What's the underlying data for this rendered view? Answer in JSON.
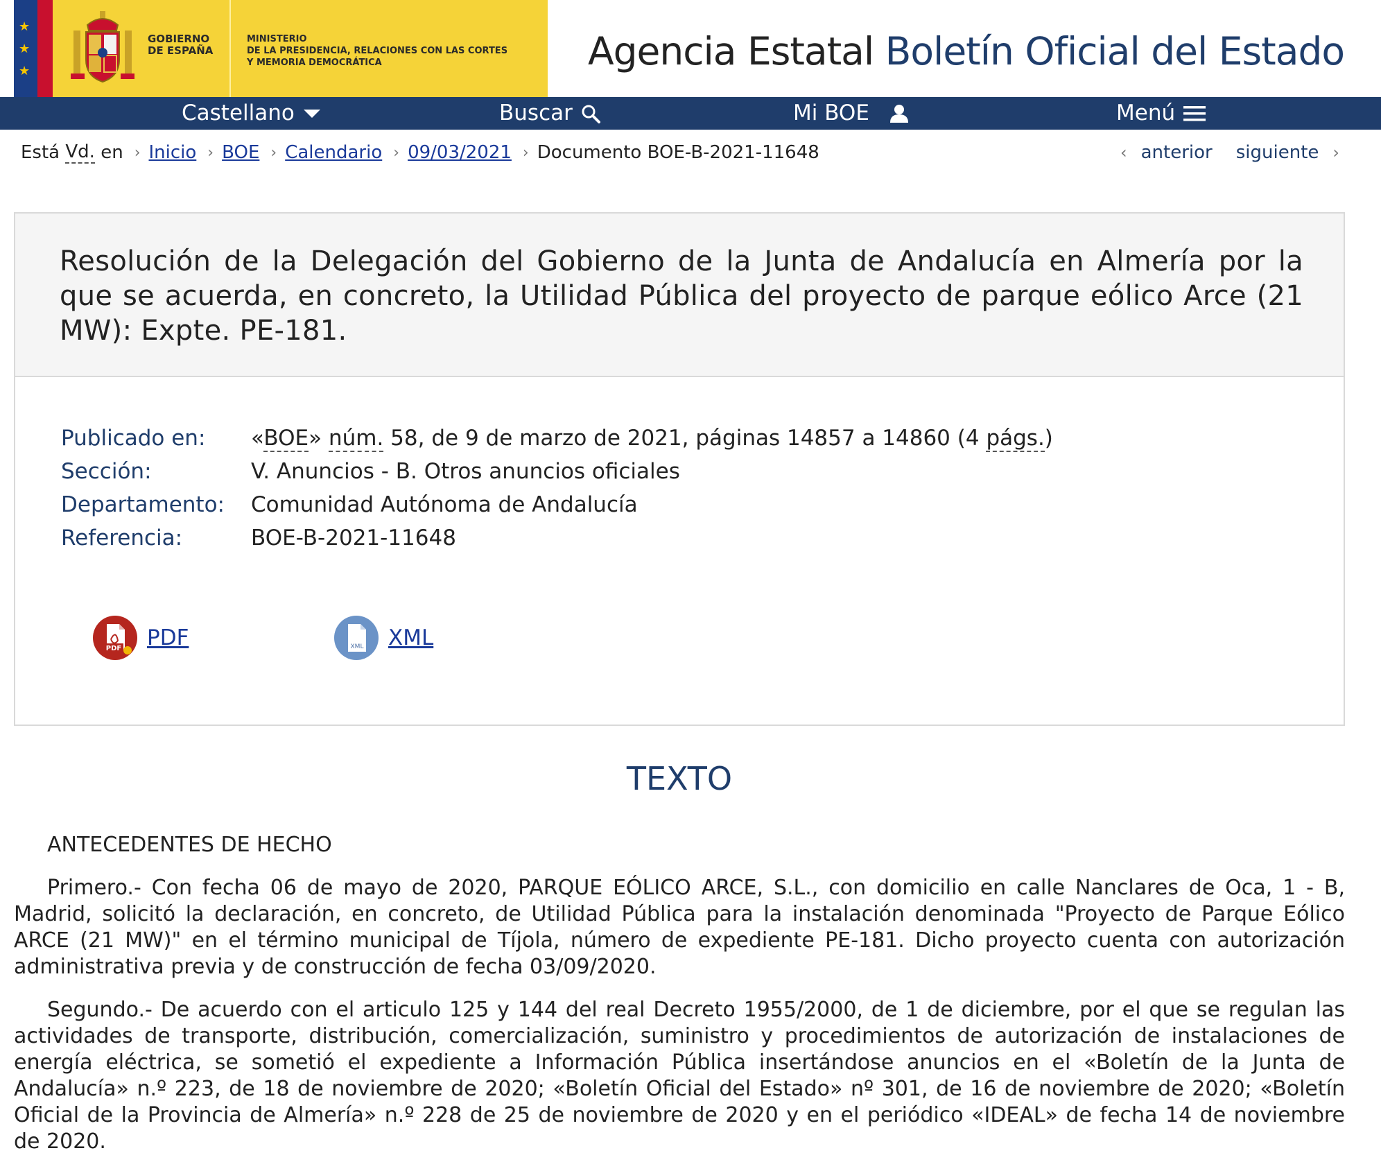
{
  "header": {
    "gov_line1": "GOBIERNO",
    "gov_line2": "DE ESPAÑA",
    "ministry_line1": "MINISTERIO",
    "ministry_line2": "DE LA PRESIDENCIA, RELACIONES CON LAS CORTES",
    "ministry_line3": "Y MEMORIA DEMOCRÁTICA",
    "site_title_plain": "Agencia Estatal",
    "site_title_highlight": "Boletín Oficial del Estado",
    "colors": {
      "nav_bg": "#1f3d6b",
      "gov_yellow": "#f5d338",
      "flag_blue": "#1b3f86",
      "flag_red": "#c8102e"
    }
  },
  "nav": {
    "language": "Castellano",
    "search": "Buscar",
    "my_boe": "Mi BOE",
    "menu": "Menú",
    "icons": [
      "chevron-down-icon",
      "search-icon",
      "user-icon",
      "hamburger-icon"
    ]
  },
  "breadcrumb": {
    "prefix_1": "Está",
    "prefix_abbr": "Vd.",
    "prefix_2": "en",
    "items": [
      "Inicio",
      "BOE",
      "Calendario",
      "09/03/2021"
    ],
    "current": "Documento BOE-B-2021-11648"
  },
  "pager": {
    "previous": "anterior",
    "next": "siguiente"
  },
  "document": {
    "title": "Resolución de la Delegación del Gobierno de la Junta de Andalucía en Almería por la que se acuerda, en concreto, la Utilidad Pública del proyecto de parque eólico Arce (21 MW): Expte. PE-181.",
    "meta": {
      "published_label": "Publicado en:",
      "published_v1": "«",
      "published_abbr1": "BOE",
      "published_v2": "» ",
      "published_abbr2": "núm.",
      "published_v3": " 58, de 9 de marzo de 2021, páginas 14857 a 14860 (4 ",
      "published_abbr3": "págs.",
      "published_v4": ")",
      "section_label": "Sección:",
      "section_value": "V. Anuncios - B. Otros anuncios oficiales",
      "department_label": "Departamento:",
      "department_value": "Comunidad Autónoma de Andalucía",
      "reference_label": "Referencia:",
      "reference_value": "BOE-B-2021-11648"
    },
    "downloads": {
      "pdf": "PDF",
      "pdf_icon_text": "PDF",
      "xml": "XML",
      "xml_icon_text": "XML"
    }
  },
  "text": {
    "heading": "TEXTO",
    "antecedentes": "ANTECEDENTES DE HECHO",
    "primero": "Primero.- Con fecha 06 de mayo de 2020, PARQUE EÓLICO ARCE, S.L., con domicilio en calle Nanclares de Oca, 1 - B, Madrid, solicitó la declaración, en concreto, de Utilidad Pública para la instalación denominada \"Proyecto de Parque Eólico ARCE (21 MW)\" en el término municipal de Tíjola, número de expediente PE-181. Dicho proyecto cuenta con autorización administrativa previa y de construcción de fecha 03/09/2020.",
    "segundo": "Segundo.- De acuerdo con el articulo 125 y 144 del real Decreto 1955/2000, de 1 de diciembre, por el que se regulan las actividades de transporte, distribución, comercialización, suministro y procedimientos de autorización de instalaciones de energía eléctrica, se sometió el expediente a Información Pública insertándose anuncios en el «Boletín de la Junta de Andalucía» n.º 223, de 18 de noviembre de 2020; «Boletín Oficial del Estado» nº 301, de 16 de noviembre de 2020; «Boletín Oficial de la Provincia de Almería» n.º 228 de 25 de noviembre de 2020 y en el periódico «IDEAL» de fecha 14 de noviembre de 2020."
  }
}
